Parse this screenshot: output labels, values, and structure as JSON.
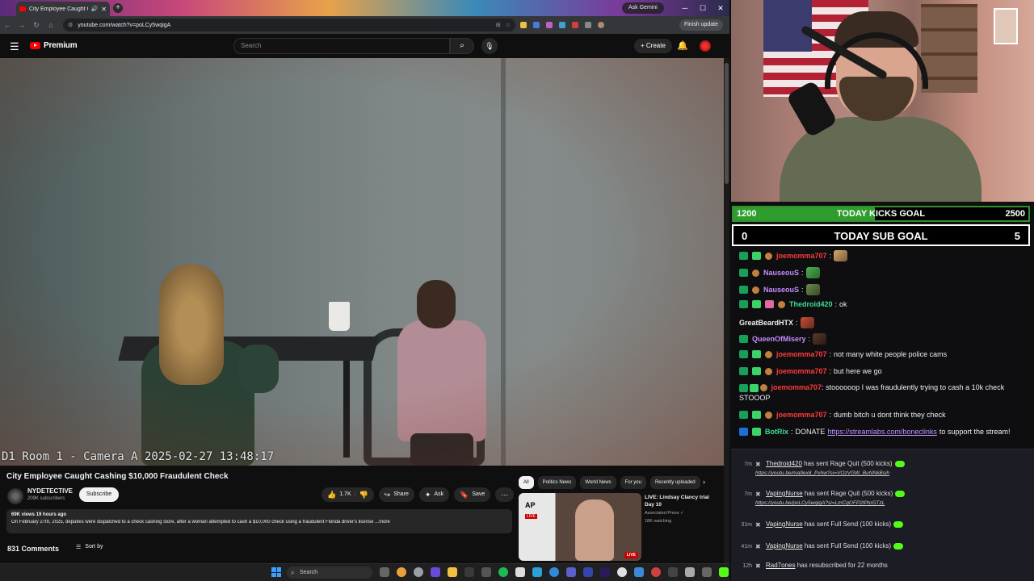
{
  "browser": {
    "tab_title": "City Employee Caught Cashi",
    "gemini_label": "Ask Gemini",
    "url": "youtube.com/watch?v=poLCy5wqigA",
    "finish_update_label": "Finish update"
  },
  "youtube": {
    "logo_text": "Premium",
    "search_placeholder": "Search",
    "create_label": "Create",
    "video_caption": "D1 Room 1 - Camera A 2025-02-27 13:48:17",
    "title": "City Employee Caught Cashing $10,000 Fraudulent Check",
    "channel_name": "NYDETECTIVE",
    "channel_subs": "209K subscribers",
    "subscribe_label": "Subscribe",
    "likes": "1.7K",
    "share_label": "Share",
    "ask_label": "Ask",
    "save_label": "Save",
    "desc_meta": "69K views  19 hours ago",
    "desc_text": "On February 27th, 2025, deputies were dispatched to a check cashing store, after a woman attempted to cash a $10,000 check using a fraudulent Florida driver's license ...more",
    "comments_count": "831 Comments",
    "sort_label": "Sort by",
    "chips": [
      "All",
      "Politics News",
      "World News",
      "For you",
      "Recently uploaded"
    ],
    "rec": {
      "title": "LIVE: Lindsay Clancy trial Day 10",
      "channel": "Associated Press ✓",
      "watching": "18K watching",
      "logo": "AP",
      "small_live": "LIVE",
      "live_badge": "LIVE"
    }
  },
  "taskbar": {
    "search_label": "Search"
  },
  "goals": {
    "kicks": {
      "current": "1200",
      "label": "TODAY KICKS GOAL",
      "target": "2500",
      "progress": 0.48
    },
    "subs": {
      "current": "0",
      "label": "TODAY SUB GOAL",
      "target": "5"
    }
  },
  "chat": [
    {
      "user": "joemomma707",
      "color": "#ff3b3b",
      "text": "",
      "emote": true
    },
    {
      "user": "NauseouS",
      "color": "#c38bff",
      "text": "",
      "emote": true
    },
    {
      "user": "NauseouS",
      "color": "#c38bff",
      "text": "",
      "emote": true
    },
    {
      "user": "Thedroid420",
      "color": "#3ddc97",
      "text": "ok"
    },
    {
      "user": "GreatBeardHTX",
      "color": "#efeff1",
      "text": "",
      "emote": true
    },
    {
      "user": "QueenOfMisery",
      "color": "#c38bff",
      "text": "",
      "emote": true
    },
    {
      "user": "joemomma707",
      "color": "#ff3b3b",
      "text": "not many white people police cams"
    },
    {
      "user": "joemomma707",
      "color": "#ff3b3b",
      "text": "but here we go"
    },
    {
      "user": "joemomma707",
      "color": "#ff3b3b",
      "text": "stoooooop I was fraudulently trying to cash a 10k check STOOOP"
    },
    {
      "user": "joemomma707",
      "color": "#ff3b3b",
      "text": "dumb bitch u dont think they check"
    },
    {
      "user": "BotRix",
      "color": "#3ddc97",
      "text_before": "DONATE ",
      "link": "https://streamlabs.com/boneclinks",
      "text_after": " to support the stream!"
    }
  ],
  "events": [
    {
      "time": "7m",
      "user": "Thedroid420",
      "action": "has sent Rage Quit (500 kicks)",
      "link": "https://youtu.be/ma9ex8_Pvhw?si=VOzVGW_BuNNkBsih"
    },
    {
      "time": "7m",
      "user": "VapingNurse",
      "action": "has sent Rage Quit (500 kicks)",
      "link": "https://youtu.be/poLCy5wqigA?si=LmCqOFP2tPtoGTzL"
    },
    {
      "time": "31m",
      "user": "VapingNurse",
      "action": "has sent Full Send (100 kicks)"
    },
    {
      "time": "41m",
      "user": "VapingNurse",
      "action": "has sent Full Send (100 kicks)"
    },
    {
      "time": "12h",
      "user": "Rad7ones",
      "action": "has resubscribed for 22 months"
    }
  ],
  "colors": {
    "kick_green": "#53fc18",
    "yt_red": "#ff0000",
    "goal_green": "#2e9d2e"
  }
}
